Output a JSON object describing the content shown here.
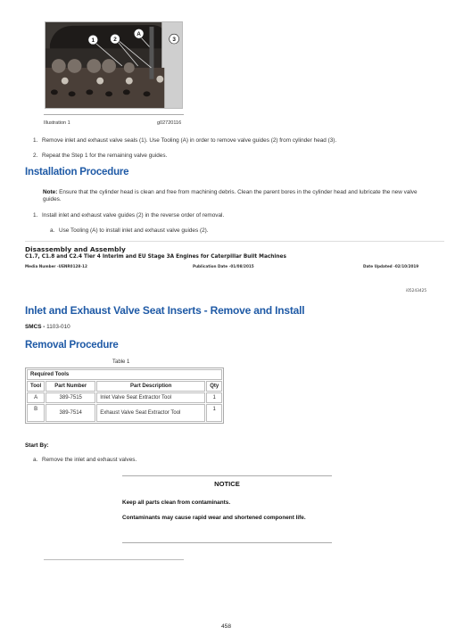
{
  "illustration": {
    "callouts": [
      "1",
      "2",
      "A",
      "3"
    ],
    "label": "Illustration 1",
    "id": "g02720116"
  },
  "removal_steps": [
    {
      "num": "1.",
      "text": "Remove inlet and exhaust valve seals (1). Use Tooling (A) in order to remove valve guides (2) from cylinder head (3)."
    },
    {
      "num": "2.",
      "text": "Repeat the Step 1 for the remaining valve guides."
    }
  ],
  "installation": {
    "heading": "Installation Procedure",
    "note_label": "Note:",
    "note_text": " Ensure that the cylinder head is clean and free from machining debris. Clean the parent bores in the cylinder head and lubricate the new valve guides.",
    "steps": [
      {
        "num": "1.",
        "text": "Install inlet and exhaust valve guides (2) in the reverse order of removal."
      }
    ],
    "substeps": [
      {
        "num": "a.",
        "text": "Use Tooling (A) to install inlet and exhaust valve guides (2)."
      }
    ]
  },
  "doc_header": {
    "title": "Disassembly and Assembly",
    "subtitle": "C1.7, C1.8 and C2.4 Tier 4 Interim and EU Stage 3A Engines for Caterpillar Built Machines",
    "media_number": "Media Number -UENR0128-12",
    "publication_date": "Publication Date -01/08/2015",
    "date_updated": "Date Updated -02/10/2019",
    "doc_id": "i05243425"
  },
  "section": {
    "title": "Inlet and Exhaust Valve Seat Inserts - Remove and Install",
    "smcs_label": "SMCS - ",
    "smcs_value": "1103-010",
    "removal_heading": "Removal Procedure"
  },
  "table": {
    "caption": "Table 1",
    "group_header": "Required Tools",
    "columns": [
      "Tool",
      "Part Number",
      "Part Description",
      "Qty"
    ],
    "rows": [
      {
        "tool": "A",
        "part_number": "389-7515",
        "description": "Inlet Valve Seat Extractor Tool",
        "qty": "1"
      },
      {
        "tool": "B",
        "part_number": "389-7514",
        "description": "Exhaust Valve Seat Extractor Tool",
        "qty": "1"
      }
    ]
  },
  "start_by": {
    "label": "Start By:",
    "items": [
      {
        "num": "a.",
        "text": "Remove the inlet and exhaust valves."
      }
    ]
  },
  "notice": {
    "title": "NOTICE",
    "lines": [
      "Keep all parts clean from contaminants.",
      "Contaminants may cause rapid wear and shortened component life."
    ]
  },
  "page_number": "458",
  "colors": {
    "heading_blue": "#1f5aa6"
  }
}
